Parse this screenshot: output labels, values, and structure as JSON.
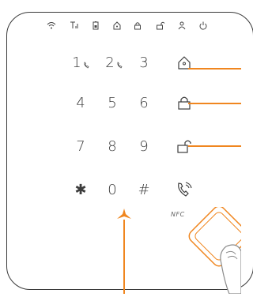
{
  "status_icons": [
    "wifi-icon",
    "signal-icon",
    "battery-icon",
    "home-mode-icon",
    "lock-mode-icon",
    "unlock-mode-icon",
    "user-icon",
    "power-icon"
  ],
  "keypad": {
    "keys": [
      {
        "label": "1",
        "sub": "call-icon"
      },
      {
        "label": "2",
        "sub": "call-icon"
      },
      {
        "label": "3"
      },
      {
        "label": "4"
      },
      {
        "label": "5"
      },
      {
        "label": "6"
      },
      {
        "label": "7"
      },
      {
        "label": "8"
      },
      {
        "label": "9"
      },
      {
        "label": "✱"
      },
      {
        "label": "0"
      },
      {
        "label": "#"
      }
    ]
  },
  "function_keys": [
    "home-arm-icon",
    "arm-lock-icon",
    "disarm-unlock-icon",
    "sos-call-icon"
  ],
  "accent_color": "#f0861f",
  "logo_text": "NFC"
}
